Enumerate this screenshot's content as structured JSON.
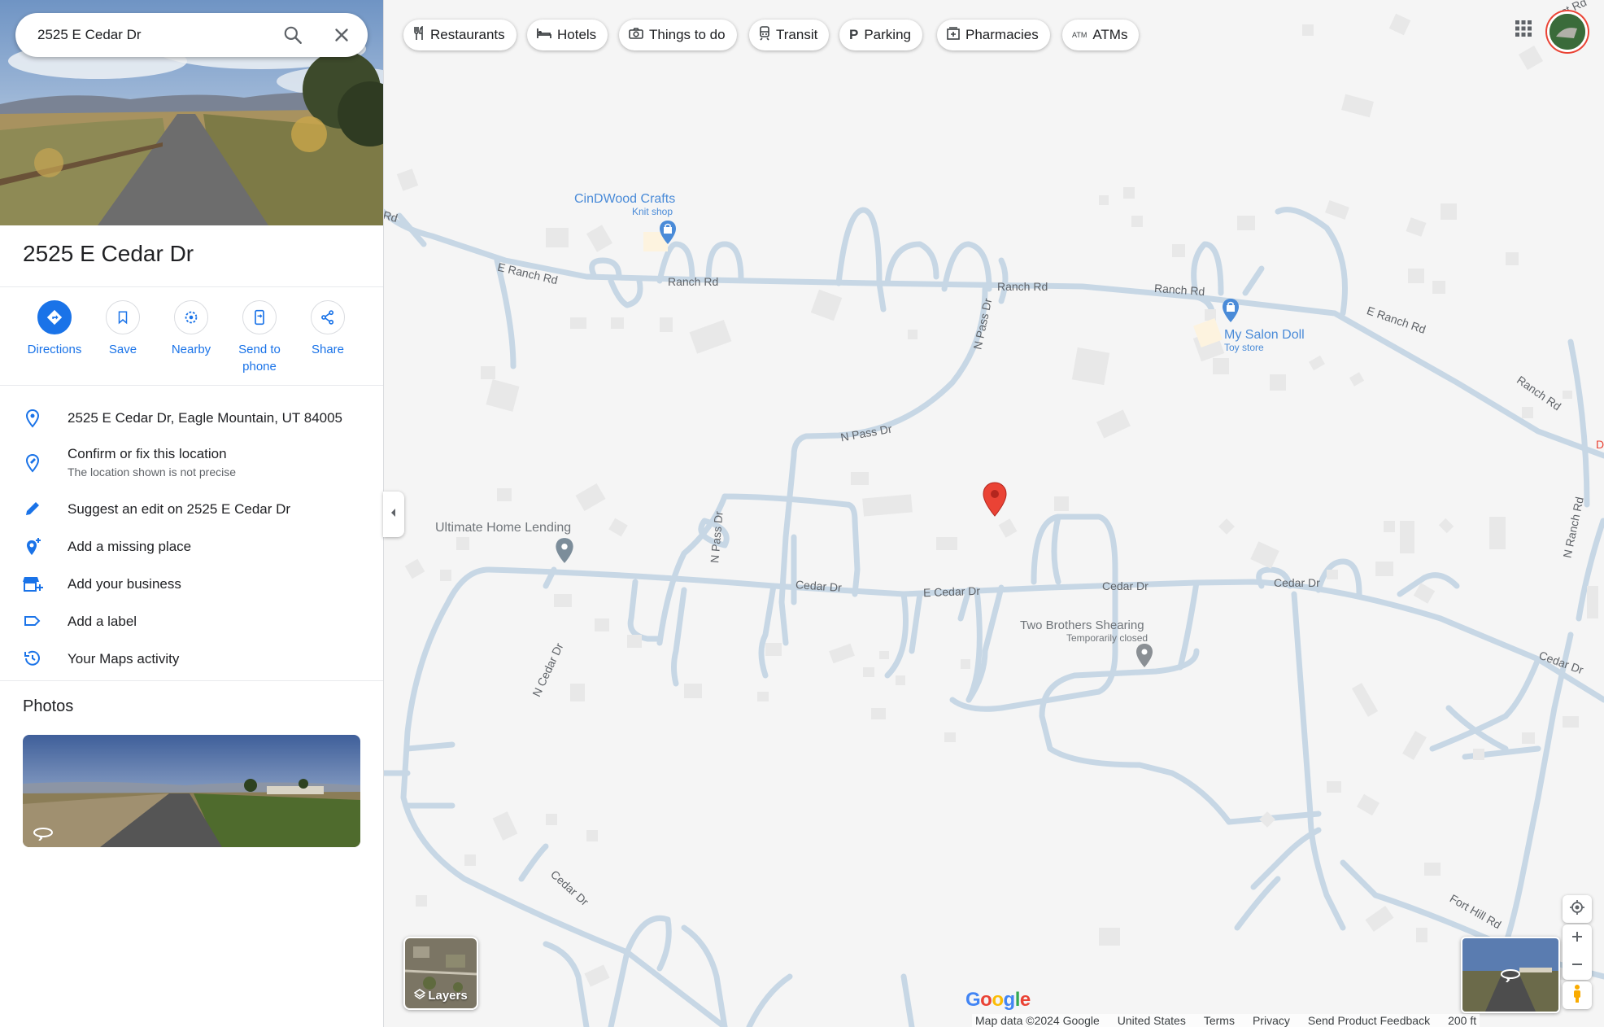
{
  "search": {
    "query": "2525 E Cedar Dr"
  },
  "place": {
    "title": "2525 E Cedar Dr"
  },
  "actions": [
    {
      "label": "Directions"
    },
    {
      "label": "Save"
    },
    {
      "label": "Nearby"
    },
    {
      "label": "Send to phone"
    },
    {
      "label": "Share"
    }
  ],
  "info": {
    "address": "2525 E Cedar Dr, Eagle Mountain, UT 84005",
    "confirm": "Confirm or fix this location",
    "confirm_sub": "The location shown is not precise",
    "suggest": "Suggest an edit on 2525 E Cedar Dr",
    "missing": "Add a missing place",
    "business": "Add your business",
    "label": "Add a label",
    "activity": "Your Maps activity"
  },
  "photos": {
    "title": "Photos"
  },
  "chips": [
    {
      "label": "Restaurants",
      "icon": "fork-knife-icon"
    },
    {
      "label": "Hotels",
      "icon": "bed-icon"
    },
    {
      "label": "Things to do",
      "icon": "camera-icon"
    },
    {
      "label": "Transit",
      "icon": "train-icon"
    },
    {
      "label": "Parking",
      "icon": "parking-icon"
    },
    {
      "label": "Pharmacies",
      "icon": "pharmacy-icon"
    },
    {
      "label": "ATMs",
      "icon": "atm-icon"
    }
  ],
  "map": {
    "roads": {
      "rd_w": "Rd",
      "e_ranch_1": "E Ranch Rd",
      "ranch_1": "Ranch Rd",
      "ranch_2": "Ranch Rd",
      "ranch_3": "Ranch Rd",
      "e_ranch_2": "E Ranch Rd",
      "ranch_e": "Ranch Rd",
      "n_pass_1": "N Pass Dr",
      "n_pass_2": "N Pass Dr",
      "n_pass_3": "N Pass Dr",
      "cedar_1": "Cedar Dr",
      "e_cedar": "E Cedar Dr",
      "cedar_2": "Cedar Dr",
      "cedar_3": "Cedar Dr",
      "cedar_4": "Cedar Dr",
      "n_cedar": "N Cedar Dr",
      "cedar_sw": "Cedar Dr",
      "n_ranch": "N Ranch Rd",
      "fort_hill": "Fort Hill Rd",
      "west_rd": "est Rd",
      "d_edge": "D"
    },
    "pois": {
      "cindwood_name": "CinDWood Crafts",
      "cindwood_type": "Knit shop",
      "salon_name": "My Salon Doll",
      "salon_type": "Toy store",
      "lending_name": "Ultimate Home Lending",
      "shearing_name": "Two Brothers Shearing",
      "shearing_status": "Temporarily closed"
    },
    "layers_label": "Layers",
    "logo": "Google",
    "footer": {
      "data": "Map data ©2024 Google",
      "country": "United States",
      "terms": "Terms",
      "privacy": "Privacy",
      "feedback": "Send Product Feedback",
      "scale": "200 ft"
    }
  },
  "colors": {
    "accent": "#1a73e8",
    "road": "#c7d7e5",
    "pin": "#ea4335"
  }
}
